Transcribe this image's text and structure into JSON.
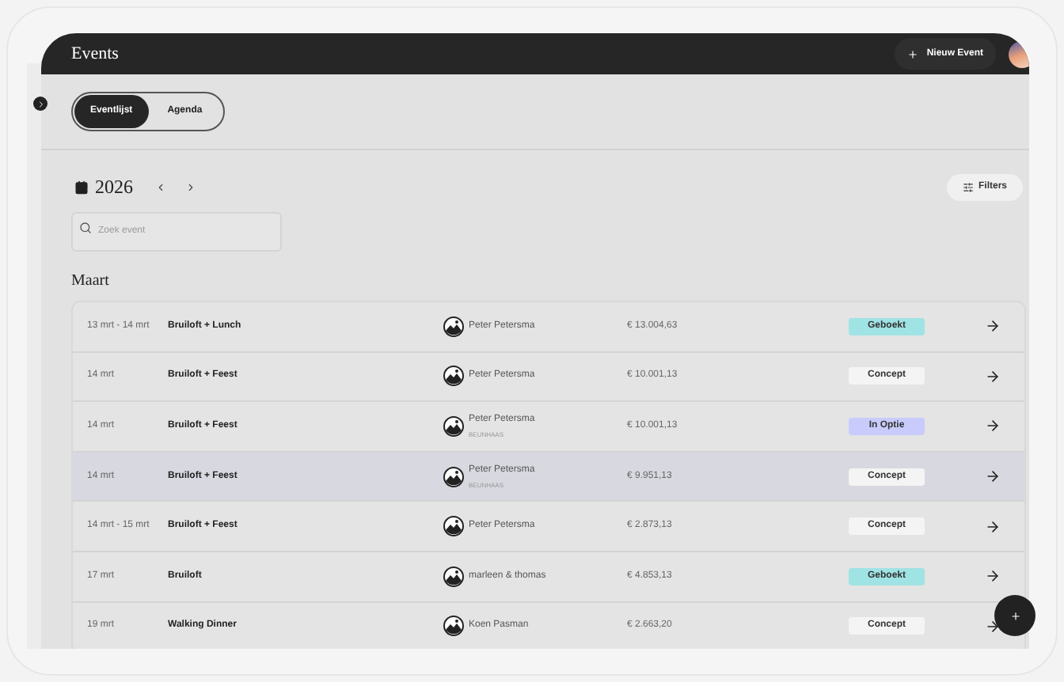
{
  "header": {
    "title": "Events",
    "new_button": "Nieuw Event"
  },
  "tabs": [
    {
      "label": "Eventlijst",
      "selected": true
    },
    {
      "label": "Agenda",
      "selected": false
    }
  ],
  "year": "2026",
  "filters_button": "Filters",
  "search": {
    "placeholder": "Zoek event"
  },
  "month": "Maart",
  "rows": [
    {
      "date": "13 mrt - 14 mrt",
      "name": "Bruiloft + Lunch",
      "person": "Peter Petersma",
      "price": "€ 13.004,63",
      "status": "Geboekt",
      "color": "#a0e3e4",
      "selected": false
    },
    {
      "date": "14 mrt",
      "name": "Bruiloft + Feest",
      "person": "Peter Petersma",
      "price": "€ 10.001,13",
      "status": "Concept",
      "color": "#f4f4f4",
      "selected": false
    },
    {
      "date": "14 mrt",
      "name": "Bruiloft + Feest",
      "person": "Peter Petersma",
      "subtitle": "BEUNHAAS",
      "price": "€ 10.001,13",
      "status": "In Optie",
      "color": "#c9cbfd",
      "selected": false
    },
    {
      "date": "14 mrt",
      "name": "Bruiloft + Feest",
      "person": "Peter Petersma",
      "subtitle": "BEUNHAAS",
      "price": "€ 9.951,13",
      "status": "Concept",
      "color": "#f4f4f4",
      "selected": true
    },
    {
      "date": "14 mrt - 15 mrt",
      "name": "Bruiloft + Feest",
      "person": "Peter Petersma",
      "price": "€ 2.873,13",
      "status": "Concept",
      "color": "#f4f4f4",
      "selected": false
    },
    {
      "date": "17 mrt",
      "name": "Bruiloft",
      "person": "marleen & thomas",
      "price": "€ 4.853,13",
      "status": "Geboekt",
      "color": "#a0e3e4",
      "selected": false
    },
    {
      "date": "19 mrt",
      "name": "Walking Dinner",
      "person": "Koen Pasman",
      "price": "€ 2.663,20",
      "status": "Concept",
      "color": "#f4f4f4",
      "selected": false
    }
  ]
}
